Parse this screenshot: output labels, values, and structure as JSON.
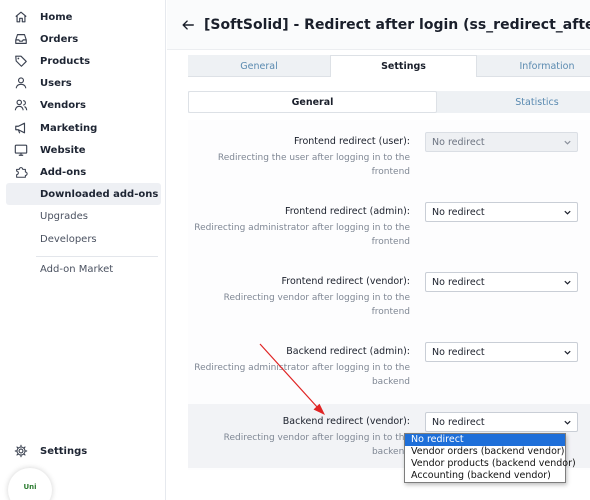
{
  "sidebar": {
    "items": [
      {
        "label": "Home",
        "icon": "home-icon"
      },
      {
        "label": "Orders",
        "icon": "inbox-icon"
      },
      {
        "label": "Products",
        "icon": "tag-icon"
      },
      {
        "label": "Users",
        "icon": "users-icon"
      },
      {
        "label": "Vendors",
        "icon": "vendors-icon"
      },
      {
        "label": "Marketing",
        "icon": "megaphone-icon"
      },
      {
        "label": "Website",
        "icon": "monitor-icon"
      },
      {
        "label": "Add-ons",
        "icon": "puzzle-icon"
      }
    ],
    "subitems": [
      {
        "label": "Downloaded add-ons",
        "active": true
      },
      {
        "label": "Upgrades"
      },
      {
        "label": "Developers"
      },
      {
        "label": "Add-on Market"
      }
    ],
    "settings_label": "Settings",
    "avatar_text": "Uni"
  },
  "header": {
    "title": "[SoftSolid] - Redirect after login (ss_redirect_after)"
  },
  "tabs": [
    "General",
    "Settings",
    "Information"
  ],
  "subtabs": [
    "General",
    "Statistics"
  ],
  "fields": [
    {
      "label": "Frontend redirect (user):",
      "description": "Redirecting the user after logging in to the frontend",
      "value": "No redirect",
      "disabled": true
    },
    {
      "label": "Frontend redirect (admin):",
      "description": "Redirecting administrator after logging in to the frontend",
      "value": "No redirect",
      "disabled": false
    },
    {
      "label": "Frontend redirect (vendor):",
      "description": "Redirecting vendor after logging in to the frontend",
      "value": "No redirect",
      "disabled": false
    },
    {
      "label": "Backend redirect (admin):",
      "description": "Redirecting administrator after logging in to the backend",
      "value": "No redirect",
      "disabled": false
    },
    {
      "label": "Backend redirect (vendor):",
      "description": "Redirecting vendor after logging in to the backend",
      "value": "No redirect",
      "disabled": false
    }
  ],
  "dropdown": {
    "options": [
      "No redirect",
      "Vendor orders (backend vendor)",
      "Vendor products (backend vendor)",
      "Accounting (backend vendor)"
    ]
  },
  "colors": {
    "accent_link": "#5a8ab0",
    "selected_option": "#1e6fd9",
    "annotation_arrow": "#e02424"
  }
}
